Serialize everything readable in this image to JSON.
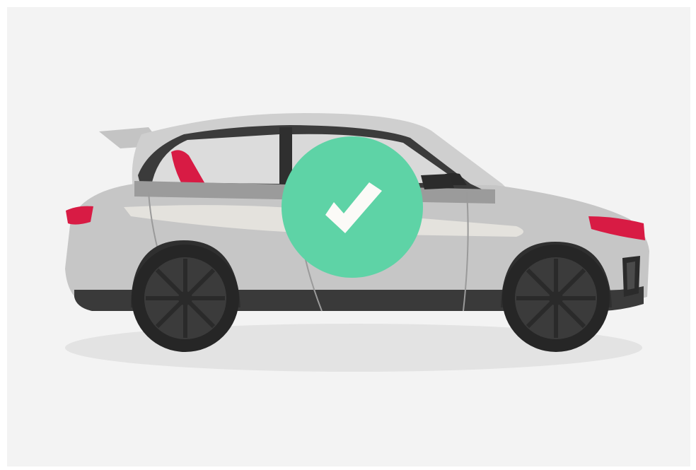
{
  "scene": {
    "subject": "car-illustration",
    "status_icon": "checkmark-icon",
    "colors": {
      "background": "#f3f3f3",
      "body": "#c9c9c9",
      "body_dark": "#8c8c8c",
      "tyre": "#2b2b2b",
      "accent_red": "#d81b44",
      "check_circle": "#5ed3a6",
      "check_mark": "#fbfaf7",
      "shadow": "#e3e3e3"
    }
  }
}
